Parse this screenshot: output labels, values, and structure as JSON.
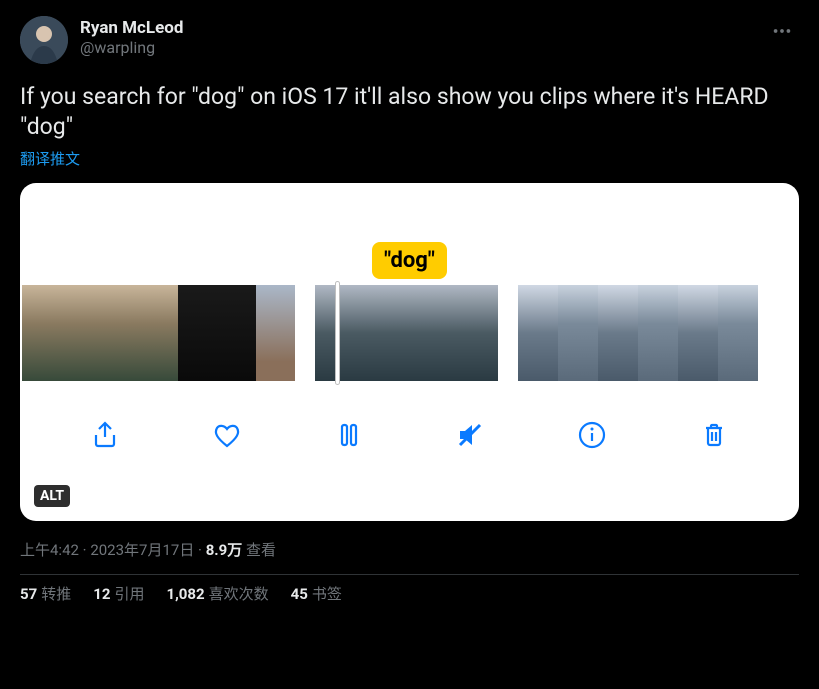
{
  "author": {
    "display_name": "Ryan McLeod",
    "handle": "@warpling"
  },
  "tweet_text": "If you search for \"dog\" on iOS 17 it'll also show you clips where it's HEARD \"dog\"",
  "translate_label": "翻译推文",
  "media": {
    "search_tag": "\"dog\"",
    "alt_badge": "ALT",
    "toolbar_icons": {
      "share": "share-icon",
      "like": "heart-icon",
      "pause": "pause-icon",
      "mute": "mute-icon",
      "info": "info-icon",
      "trash": "trash-icon"
    }
  },
  "timestamp": {
    "time": "上午4:42",
    "dot": " · ",
    "date": "2023年7月17日",
    "views_count": "8.9万",
    "views_label": " 查看"
  },
  "metrics": {
    "retweets": {
      "count": "57",
      "label": "转推"
    },
    "quotes": {
      "count": "12",
      "label": "引用"
    },
    "likes": {
      "count": "1,082",
      "label": "喜欢次数"
    },
    "bookmarks": {
      "count": "45",
      "label": "书签"
    }
  }
}
